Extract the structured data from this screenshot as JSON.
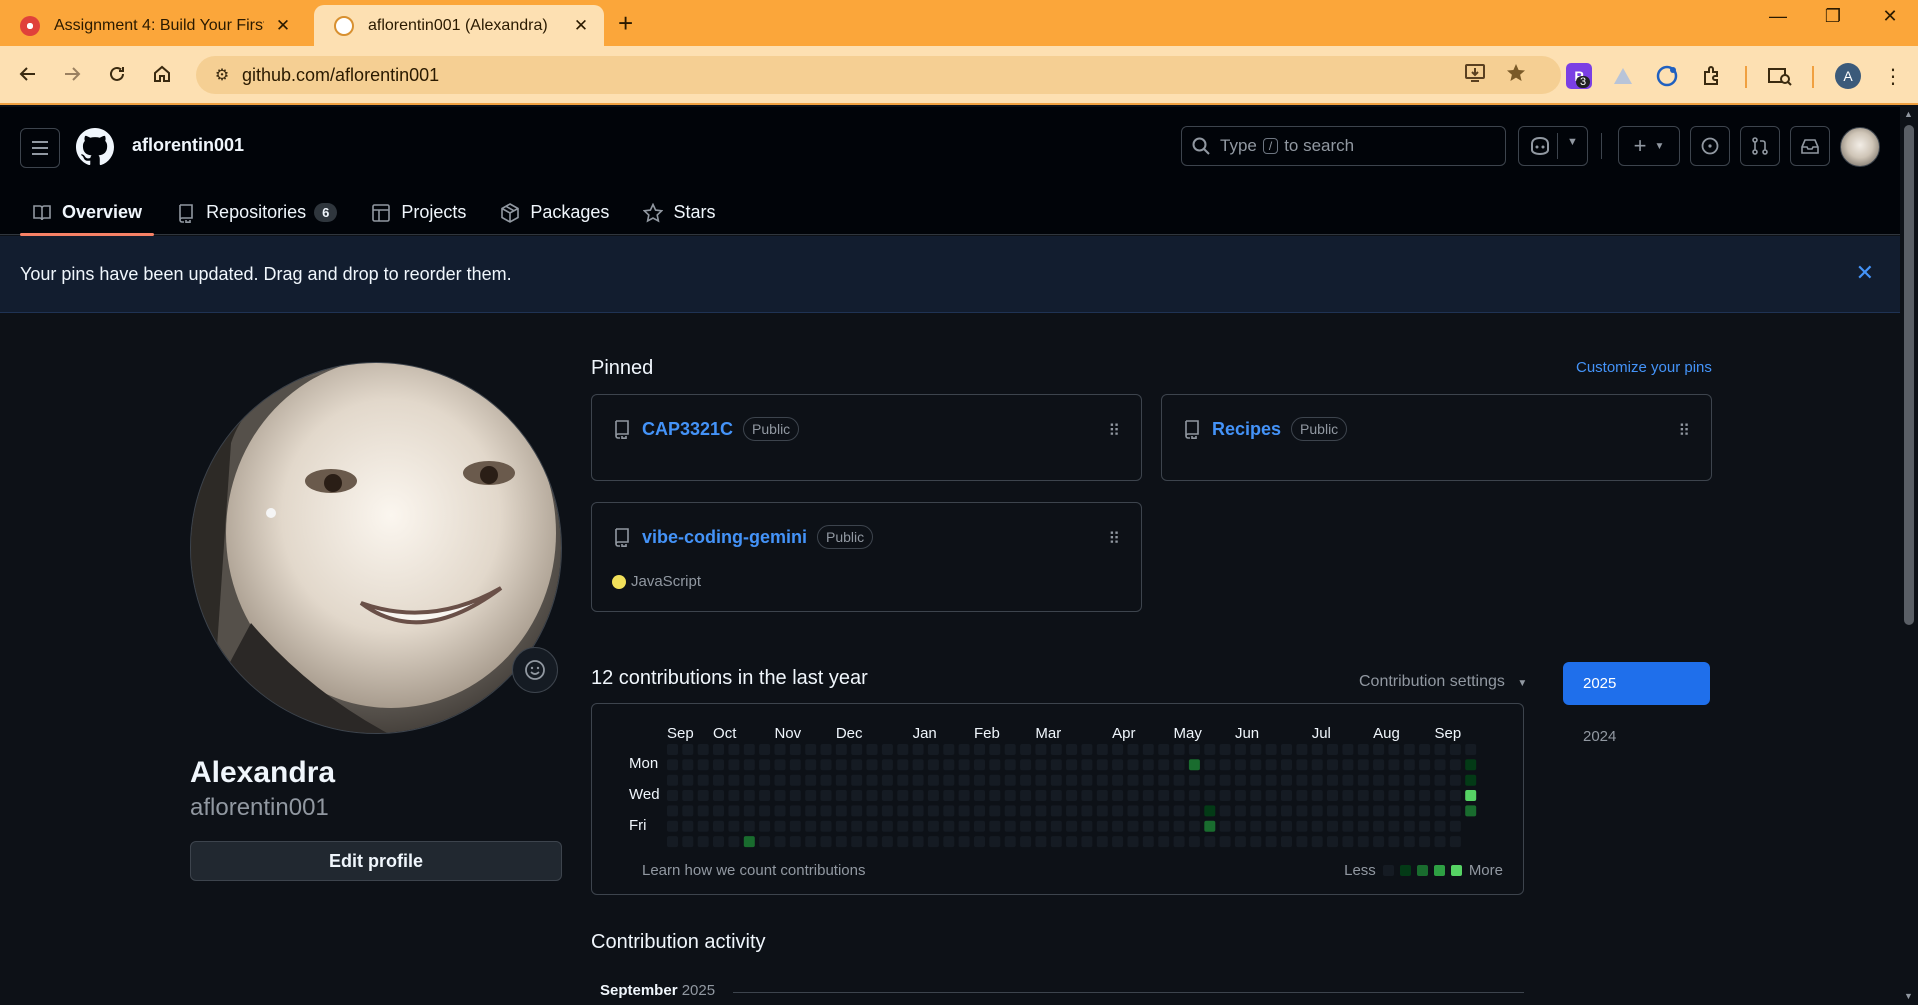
{
  "browser": {
    "tabs": [
      {
        "title": "Assignment 4: Build Your First A",
        "close": "✕"
      },
      {
        "title": "aflorentin001 (Alexandra)",
        "close": "✕"
      }
    ],
    "new_tab": "+",
    "url": "github.com/aflorentin001",
    "extension_badge": "3",
    "profile_initial": "A",
    "window_controls": {
      "minimize": "—",
      "restore": "❐",
      "close": "✕"
    }
  },
  "header": {
    "username": "aflorentin001",
    "search_prefix": "Type",
    "search_key": "/",
    "search_suffix": "to search",
    "nav": [
      {
        "label": "Overview",
        "selected": true
      },
      {
        "label": "Repositories",
        "count": "6"
      },
      {
        "label": "Projects"
      },
      {
        "label": "Packages"
      },
      {
        "label": "Stars"
      }
    ]
  },
  "flash": {
    "message": "Your pins have been updated. Drag and drop to reorder them.",
    "close": "✕"
  },
  "profile": {
    "name": "Alexandra",
    "login": "aflorentin001",
    "edit_label": "Edit profile"
  },
  "pinned": {
    "title": "Pinned",
    "customize": "Customize your pins",
    "repos": [
      {
        "name": "CAP3321C",
        "visibility": "Public"
      },
      {
        "name": "Recipes",
        "visibility": "Public"
      },
      {
        "name": "vibe-coding-gemini",
        "visibility": "Public",
        "language": "JavaScript",
        "language_color": "#f1e05a"
      }
    ]
  },
  "contributions": {
    "title": "12 contributions in the last year",
    "settings_label": "Contribution settings",
    "months": [
      "Sep",
      "Oct",
      "Nov",
      "Dec",
      "Jan",
      "Feb",
      "Mar",
      "Apr",
      "May",
      "Jun",
      "Jul",
      "Aug",
      "Sep"
    ],
    "days": [
      "Mon",
      "Wed",
      "Fri"
    ],
    "learn": "Learn how we count contributions",
    "less": "Less",
    "more": "More",
    "colors": [
      "#151b23",
      "#033a16",
      "#196c2e",
      "#2ea043",
      "#56d364"
    ],
    "years": [
      "2025",
      "2024"
    ],
    "active_cells": [
      {
        "week": 5,
        "day": 6,
        "level": 2
      },
      {
        "week": 34,
        "day": 1,
        "level": 2
      },
      {
        "week": 35,
        "day": 4,
        "level": 1
      },
      {
        "week": 35,
        "day": 5,
        "level": 2
      },
      {
        "week": 52,
        "day": 1,
        "level": 1
      },
      {
        "week": 52,
        "day": 2,
        "level": 1
      },
      {
        "week": 52,
        "day": 3,
        "level": 4
      },
      {
        "week": 52,
        "day": 4,
        "level": 2
      }
    ]
  },
  "activity": {
    "title": "Contribution activity",
    "month": "September",
    "year": "2025"
  }
}
